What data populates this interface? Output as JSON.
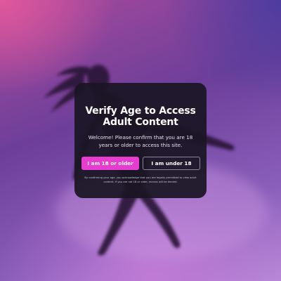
{
  "modal": {
    "title": "Verify Age to Access Adult Content",
    "subtitle": "Welcome! Please confirm that you are 18 years or older to access this site.",
    "confirm_label": "I am 18 or older",
    "deny_label": "I am under 18",
    "disclaimer": "By confirming your age, you acknowledge that you are legally permitted to view adult content. If you are not 18 or older, access will be denied."
  },
  "colors": {
    "accent": "#e63ccf",
    "modal_bg": "#1a1624"
  }
}
